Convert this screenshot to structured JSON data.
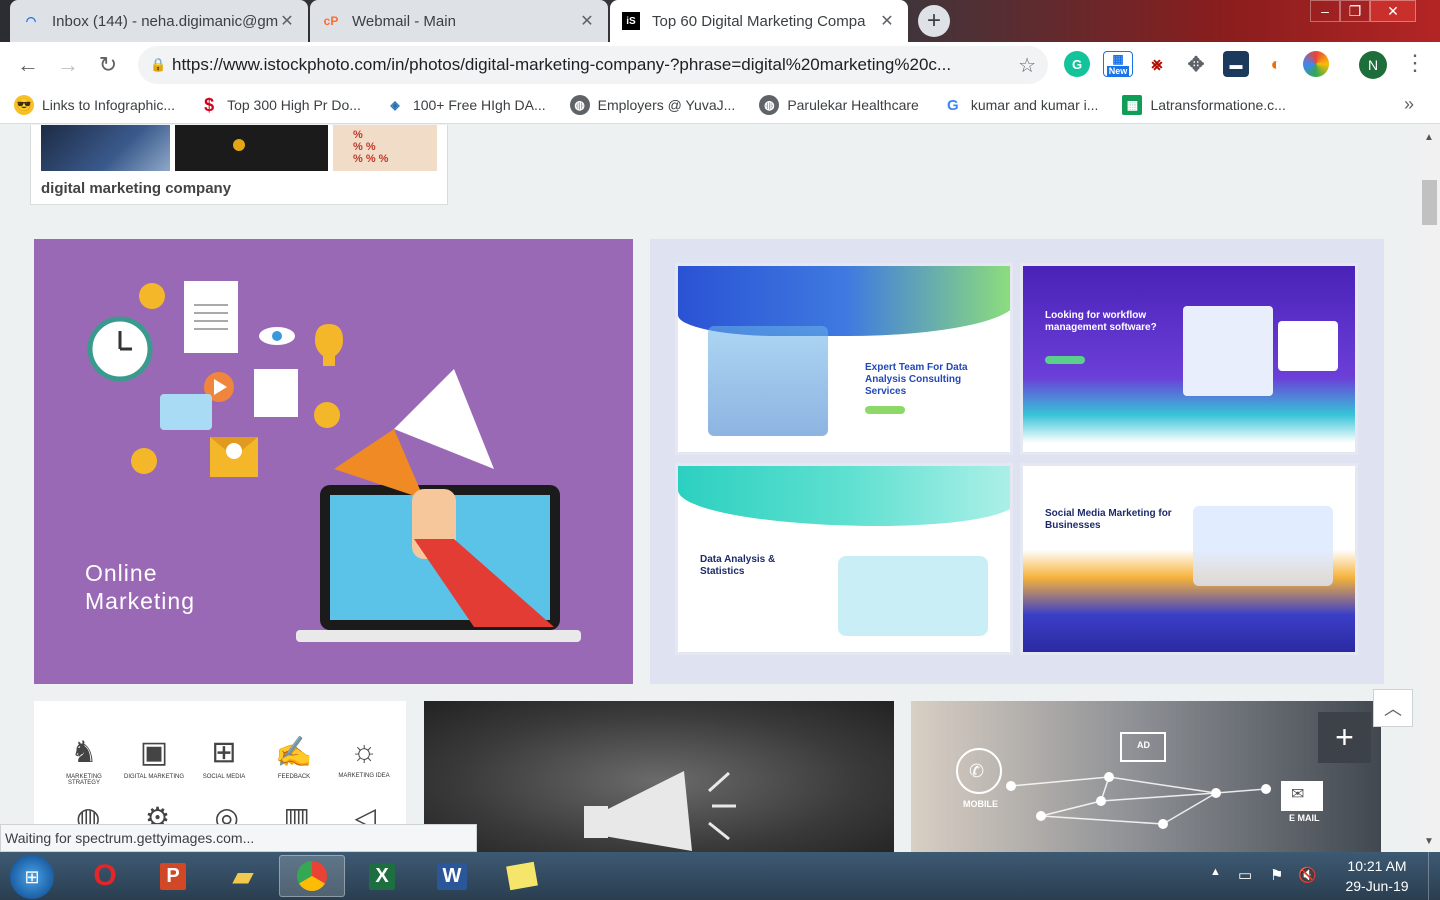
{
  "browser": {
    "tabs": [
      {
        "title": "Inbox (144) - neha.digimanic@gm",
        "icon": "gmail-loading-icon"
      },
      {
        "title": "Webmail - Main",
        "icon": "cpanel-icon"
      },
      {
        "title": "Top 60 Digital Marketing Compa",
        "icon": "istock-icon"
      }
    ],
    "url": "https://www.istockphoto.com/in/photos/digital-marketing-company-?phrase=digital%20marketing%20c...",
    "ext_new_badge": "New",
    "profile_initial": "N",
    "bookmarks": [
      {
        "label": "Links to Infographic...",
        "icon": "sunglasses-emoji-icon"
      },
      {
        "label": "Top 300 High Pr Do...",
        "icon": "dollar-icon"
      },
      {
        "label": "100+ Free HIgh DA...",
        "icon": "drop-icon"
      },
      {
        "label": "Employers @ YuvaJ...",
        "icon": "globe-icon"
      },
      {
        "label": "Parulekar Healthcare",
        "icon": "globe-icon"
      },
      {
        "label": "kumar and kumar i...",
        "icon": "google-icon"
      },
      {
        "label": "Latransformatione.c...",
        "icon": "sheets-icon"
      }
    ]
  },
  "page": {
    "related_label": "digital marketing company",
    "online_marketing_text_line1": "Online",
    "online_marketing_text_line2": "Marketing",
    "web_panels": [
      {
        "title": "Expert Team For Data Analysis Consulting Services"
      },
      {
        "title": "Looking for workflow management software?"
      },
      {
        "title": "Data Analysis & Statistics"
      },
      {
        "title": "Social Media Marketing for Businesses"
      }
    ],
    "icon_labels": [
      "MARKETING STRATEGY",
      "DIGITAL MARKETING",
      "SOCIAL MEDIA",
      "FEEDBACK",
      "MARKETING IDEA"
    ],
    "net_labels": {
      "mobile": "MOBILE",
      "ad": "AD",
      "email": "E MAIL"
    },
    "status_text": "Waiting for spectrum.gettyimages.com..."
  },
  "taskbar": {
    "clock_time": "10:21 AM",
    "clock_date": "29-Jun-19"
  }
}
